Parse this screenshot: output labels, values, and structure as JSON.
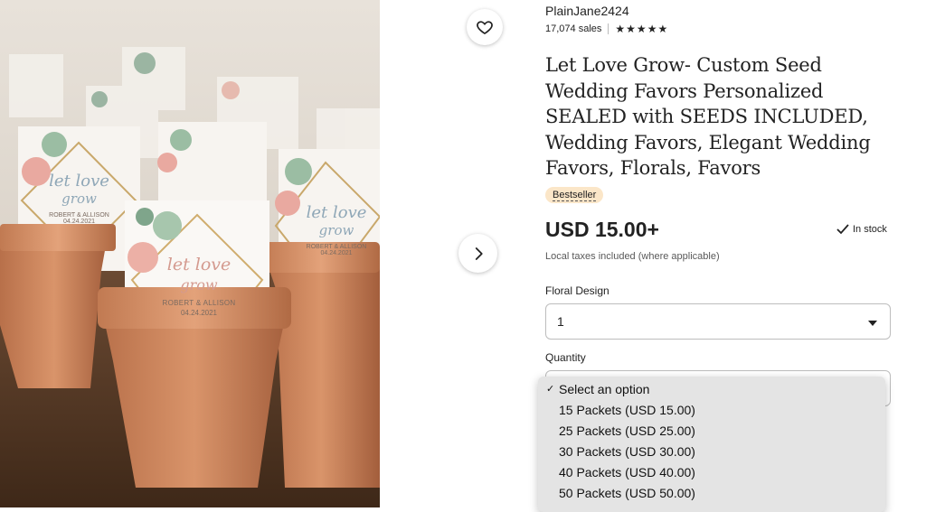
{
  "shop": {
    "name": "PlainJane2424",
    "sales": "17,074 sales",
    "rating_stars": 5
  },
  "product": {
    "title": "Let Love Grow- Custom Seed Wedding Favors Personalized SEALED with SEEDS INCLUDED, Wedding Favors, Elegant Wedding Favors, Florals, Favors",
    "badge": "Bestseller",
    "price": "USD 15.00+",
    "stock": "In stock",
    "tax_note": "Local taxes included (where applicable)"
  },
  "photo": {
    "card_script_1": "let love",
    "card_script_2": "grow",
    "card_names": "ROBERT & ALLISON",
    "card_date": "04.24.2021"
  },
  "options": {
    "floral_label": "Floral Design",
    "floral_value": "1",
    "quantity_label": "Quantity"
  },
  "quantity_dropdown": {
    "items": [
      {
        "label": "Select an option",
        "checked": true
      },
      {
        "label": "15 Packets (USD 15.00)",
        "checked": false
      },
      {
        "label": "25 Packets (USD 25.00)",
        "checked": false
      },
      {
        "label": "30 Packets (USD 30.00)",
        "checked": false
      },
      {
        "label": "40 Packets (USD 40.00)",
        "checked": false
      },
      {
        "label": "50 Packets (USD 50.00)",
        "checked": false
      }
    ]
  },
  "icons": {
    "favorite": "heart-icon",
    "next": "chevron-right-icon",
    "check": "checkmark-icon",
    "star": "star-icon"
  }
}
